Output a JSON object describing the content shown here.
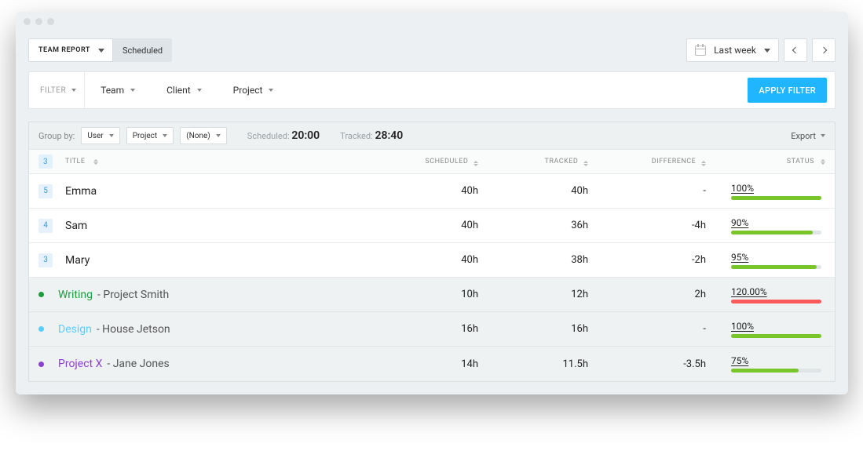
{
  "header": {
    "report_type": "TEAM REPORT",
    "scheduled_label": "Scheduled",
    "range_label": "Last week"
  },
  "filters": {
    "label": "FILTER",
    "items": [
      "Team",
      "Client",
      "Project"
    ],
    "apply_label": "APPLY FILTER"
  },
  "grouping": {
    "label": "Group by:",
    "selects": [
      "User",
      "Project",
      "(None)"
    ],
    "scheduled_label": "Scheduled:",
    "scheduled_value": "20:00",
    "tracked_label": "Tracked:",
    "tracked_value": "28:40",
    "export_label": "Export"
  },
  "columns": {
    "count": "3",
    "title": "TITLE",
    "scheduled": "SCHEDULED",
    "tracked": "TRACKED",
    "difference": "DIFFERENCE",
    "status": "STATUS"
  },
  "rows": [
    {
      "type": "user",
      "count": "5",
      "title": "Emma",
      "scheduled": "40h",
      "tracked": "40h",
      "difference": "-",
      "status_label": "100%",
      "status_pct": 100,
      "over": false
    },
    {
      "type": "user",
      "count": "4",
      "title": "Sam",
      "scheduled": "40h",
      "tracked": "36h",
      "difference": "-4h",
      "status_label": "90%",
      "status_pct": 90,
      "over": false
    },
    {
      "type": "user",
      "count": "3",
      "title": "Mary",
      "scheduled": "40h",
      "tracked": "38h",
      "difference": "-2h",
      "status_label": "95%",
      "status_pct": 95,
      "over": false
    },
    {
      "type": "project",
      "dot": "#1e9e3a",
      "name_color": "#1e9e3a",
      "name": "Writing",
      "client": "Project Smith",
      "scheduled": "10h",
      "tracked": "12h",
      "difference": "2h",
      "status_label": "120.00%",
      "status_pct": 100,
      "over": true
    },
    {
      "type": "project",
      "dot": "#56cfff",
      "name_color": "#56cfff",
      "name": "Design",
      "client": "House Jetson",
      "scheduled": "16h",
      "tracked": "16h",
      "difference": "-",
      "status_label": "100%",
      "status_pct": 100,
      "over": false
    },
    {
      "type": "project",
      "dot": "#8a3fd1",
      "name_color": "#8a3fd1",
      "name": "Project X",
      "client": "Jane Jones",
      "scheduled": "14h",
      "tracked": "11.5h",
      "difference": "-3.5h",
      "status_label": "75%",
      "status_pct": 75,
      "over": false
    }
  ]
}
